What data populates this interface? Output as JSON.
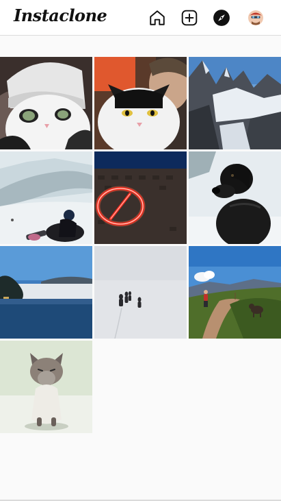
{
  "app": {
    "logo_text": "Instaclone"
  },
  "nav": {
    "icons": [
      "home-icon",
      "new-post-icon",
      "explore-compass-icon",
      "profile-avatar"
    ]
  },
  "feed": {
    "posts": [
      {
        "subject": "cat-in-hat"
      },
      {
        "subject": "cat-selfie"
      },
      {
        "subject": "mountain-peaks"
      },
      {
        "subject": "snowboarder-on-slope"
      },
      {
        "subject": "neon-sign"
      },
      {
        "subject": "black-dog-in-snow"
      },
      {
        "subject": "lake-with-fog"
      },
      {
        "subject": "hikers-in-snow"
      },
      {
        "subject": "hiker-and-dog-on-trail"
      },
      {
        "subject": "siamese-cat"
      }
    ]
  },
  "colors": {
    "background": "#fafafa",
    "header": "#ffffff",
    "border": "#dbdbdb"
  }
}
